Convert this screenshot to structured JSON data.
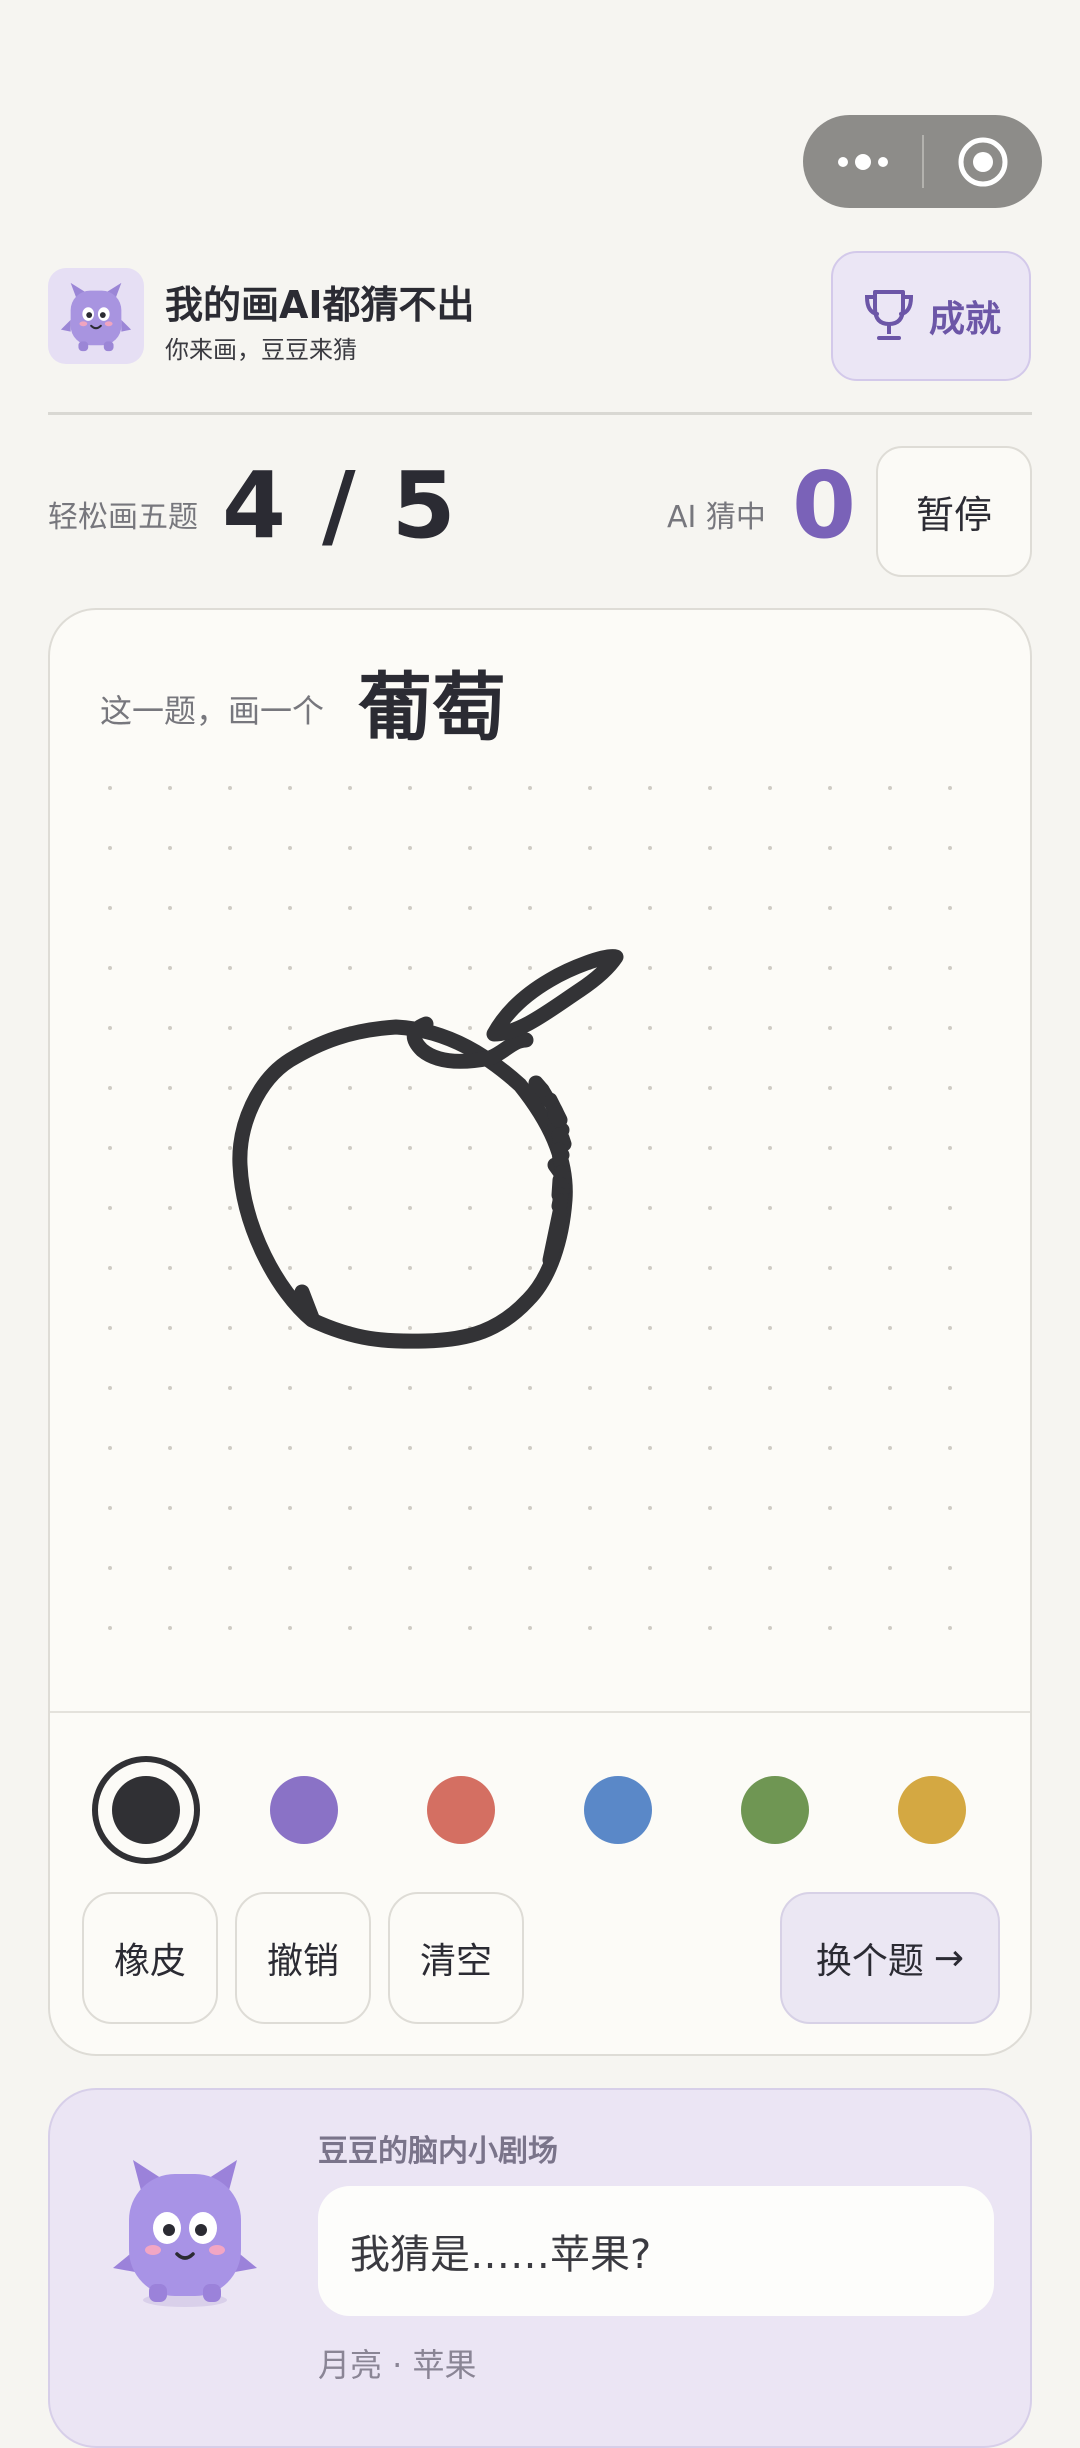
{
  "header": {
    "title": "我的画AI都猜不出",
    "subtitle": "你来画，豆豆来猜",
    "achievements_label": "成就"
  },
  "stats": {
    "round_label": "轻松画五题",
    "round_value": "4 / 5",
    "ai_label": "AI 猜中",
    "ai_value": "0",
    "pause_label": "暂停"
  },
  "prompt": {
    "label": "这一题，画一个",
    "word": "葡萄"
  },
  "palette": {
    "selected_index": 0,
    "colors": [
      "#303034",
      "#8a72c6",
      "#d46f62",
      "#5a88c8",
      "#6f9653",
      "#d4a842"
    ]
  },
  "tools": {
    "eraser": "橡皮",
    "undo": "撤销",
    "clear": "清空",
    "next": "换个题",
    "next_arrow": "→"
  },
  "ai_panel": {
    "title": "豆豆的脑内小剧场",
    "guess": "我猜是……苹果?",
    "history": "月亮 · 苹果"
  },
  "icons": {
    "capsule_more": "more-dots-icon",
    "capsule_close": "target-close-icon",
    "achievements": "trophy-icon",
    "logo": "monster-mascot-icon",
    "next": "arrow-right-icon"
  }
}
